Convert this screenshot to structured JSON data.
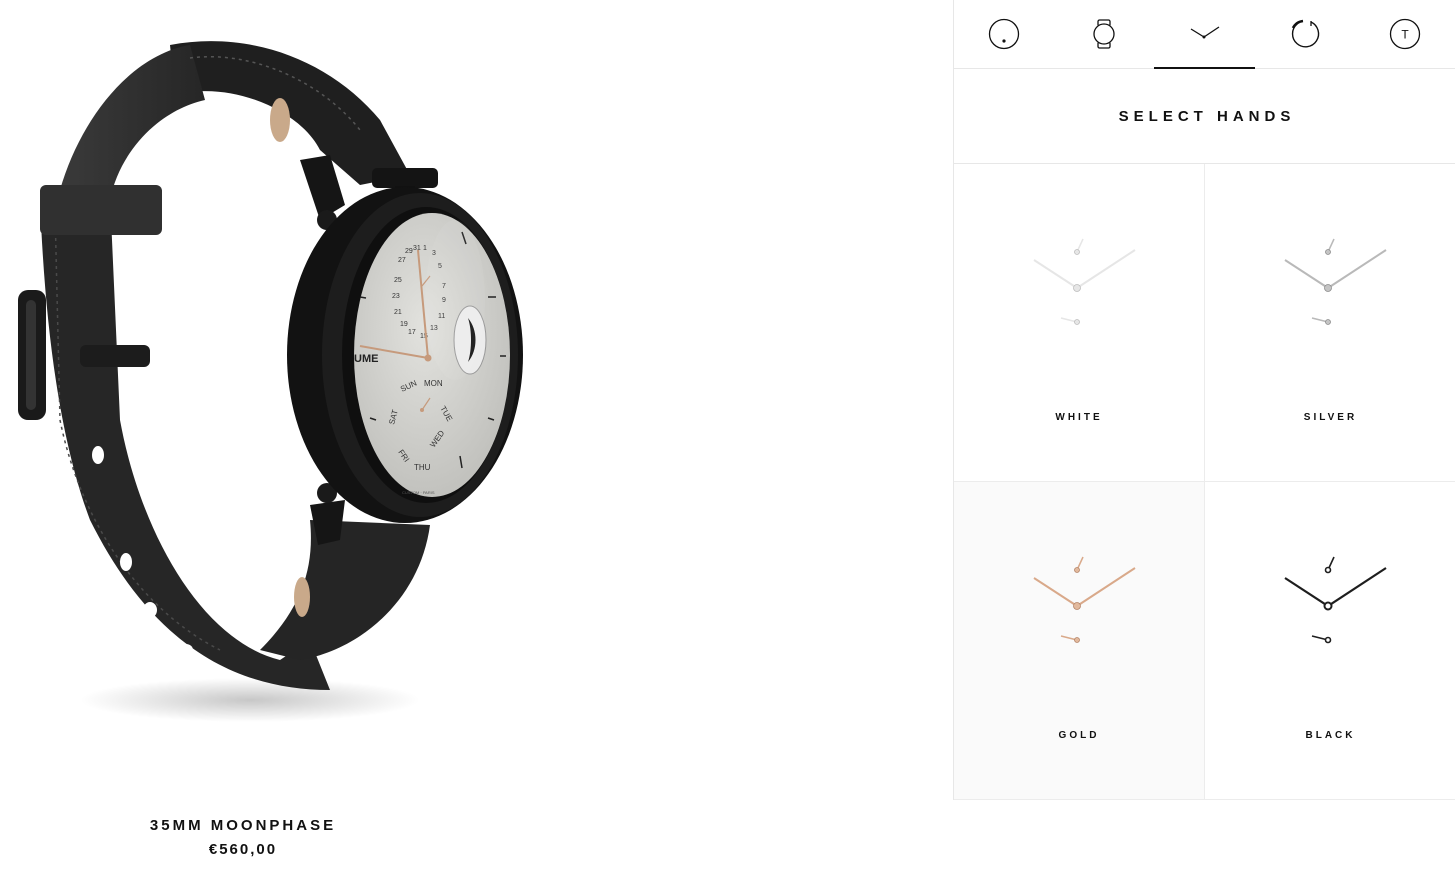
{
  "product": {
    "name": "35MM MOONPHASE",
    "price": "€560,00"
  },
  "watch": {
    "brand_fragment": "UME",
    "date_numbers": [
      "27",
      "29",
      "31",
      "1",
      "3",
      "5",
      "7",
      "9",
      "11",
      "13",
      "15",
      "17",
      "19",
      "21",
      "23",
      "25"
    ],
    "days": [
      "SUN",
      "MON",
      "TUE",
      "WED",
      "THU",
      "FRI",
      "SAT"
    ],
    "fine_print": "CUSTOM · PARIS"
  },
  "steps": [
    {
      "icon": "watch-face-icon",
      "active": false
    },
    {
      "icon": "watch-case-icon",
      "active": false
    },
    {
      "icon": "watch-hands-icon",
      "active": true
    },
    {
      "icon": "strap-icon",
      "active": false
    },
    {
      "icon": "engraving-icon",
      "active": false
    }
  ],
  "engraving_letter": "T",
  "section_title": "SELECT HANDS",
  "hand_options": [
    {
      "label": "WHITE",
      "color": "#e6e6e6"
    },
    {
      "label": "SILVER",
      "color": "#b9b9b9"
    },
    {
      "label": "GOLD",
      "color": "#d9a98a"
    },
    {
      "label": "BLACK",
      "color": "#1e1e1e"
    }
  ],
  "colors": {
    "strap": "#2b2b2b",
    "case": "#161616",
    "dial": "#d6d6d2",
    "accent": "#111111",
    "divider": "#e7e7e7"
  }
}
